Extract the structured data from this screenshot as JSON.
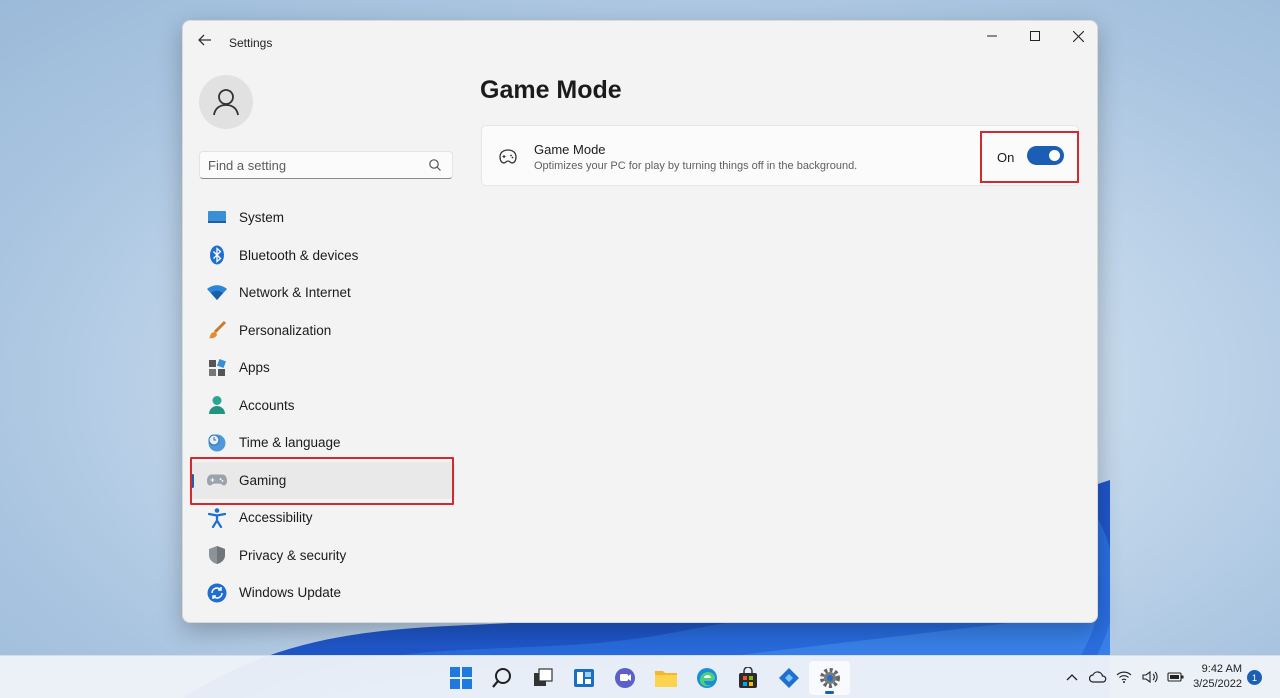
{
  "window": {
    "app_title": "Settings",
    "controls": {
      "minimize": "—",
      "maximize": "☐",
      "close": "✕"
    }
  },
  "search": {
    "placeholder": "Find a setting"
  },
  "sidebar": {
    "items": [
      {
        "label": "System",
        "icon": "system-icon"
      },
      {
        "label": "Bluetooth & devices",
        "icon": "bluetooth-icon"
      },
      {
        "label": "Network & Internet",
        "icon": "wifi-icon"
      },
      {
        "label": "Personalization",
        "icon": "brush-icon"
      },
      {
        "label": "Apps",
        "icon": "apps-icon"
      },
      {
        "label": "Accounts",
        "icon": "account-icon"
      },
      {
        "label": "Time & language",
        "icon": "clock-globe-icon"
      },
      {
        "label": "Gaming",
        "icon": "gamepad-icon",
        "active": true
      },
      {
        "label": "Accessibility",
        "icon": "accessibility-icon"
      },
      {
        "label": "Privacy & security",
        "icon": "shield-icon"
      },
      {
        "label": "Windows Update",
        "icon": "update-icon"
      }
    ]
  },
  "main": {
    "page_title": "Game Mode",
    "setting": {
      "title": "Game Mode",
      "description": "Optimizes your PC for play by turning things off in the background.",
      "state_label": "On",
      "enabled": true
    }
  },
  "taskbar": {
    "time": "9:42 AM",
    "date": "3/25/2022",
    "notification_count": "1"
  },
  "colors": {
    "accent": "#1a5fb4",
    "highlight": "#d22a2f"
  }
}
